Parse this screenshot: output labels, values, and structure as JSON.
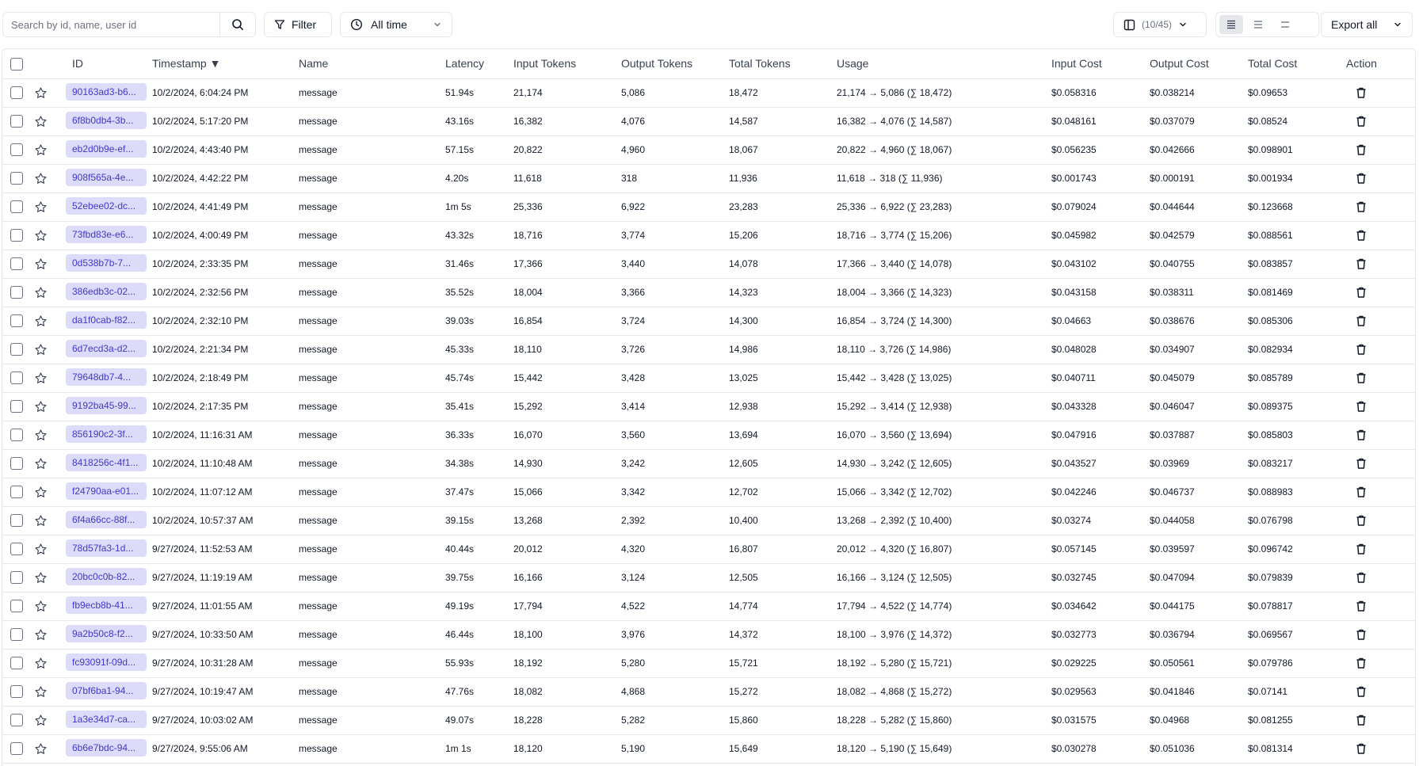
{
  "toolbar": {
    "search_placeholder": "Search by id, name, user id",
    "filter_label": "Filter",
    "time_label": "All time",
    "columns_count": "(10/45)",
    "export_label": "Export all"
  },
  "table": {
    "headers": {
      "id": "ID",
      "timestamp": "Timestamp ▼",
      "name": "Name",
      "latency": "Latency",
      "input_tokens": "Input Tokens",
      "output_tokens": "Output Tokens",
      "total_tokens": "Total Tokens",
      "usage": "Usage",
      "input_cost": "Input Cost",
      "output_cost": "Output Cost",
      "total_cost": "Total Cost",
      "action": "Action"
    },
    "rows": [
      {
        "id": "90163ad3-b6...",
        "timestamp": "10/2/2024, 6:04:24 PM",
        "name": "message",
        "latency": "51.94s",
        "input_tokens": "21,174",
        "output_tokens": "5,086",
        "total_tokens": "18,472",
        "usage": "21,174 → 5,086 (∑ 18,472)",
        "input_cost": "$0.058316",
        "output_cost": "$0.038214",
        "total_cost": "$0.09653"
      },
      {
        "id": "6f8b0db4-3b...",
        "timestamp": "10/2/2024, 5:17:20 PM",
        "name": "message",
        "latency": "43.16s",
        "input_tokens": "16,382",
        "output_tokens": "4,076",
        "total_tokens": "14,587",
        "usage": "16,382 → 4,076 (∑ 14,587)",
        "input_cost": "$0.048161",
        "output_cost": "$0.037079",
        "total_cost": "$0.08524"
      },
      {
        "id": "eb2d0b9e-ef...",
        "timestamp": "10/2/2024, 4:43:40 PM",
        "name": "message",
        "latency": "57.15s",
        "input_tokens": "20,822",
        "output_tokens": "4,960",
        "total_tokens": "18,067",
        "usage": "20,822 → 4,960 (∑ 18,067)",
        "input_cost": "$0.056235",
        "output_cost": "$0.042666",
        "total_cost": "$0.098901"
      },
      {
        "id": "908f565a-4e...",
        "timestamp": "10/2/2024, 4:42:22 PM",
        "name": "message",
        "latency": "4.20s",
        "input_tokens": "11,618",
        "output_tokens": "318",
        "total_tokens": "11,936",
        "usage": "11,618 → 318 (∑ 11,936)",
        "input_cost": "$0.001743",
        "output_cost": "$0.000191",
        "total_cost": "$0.001934"
      },
      {
        "id": "52ebee02-dc...",
        "timestamp": "10/2/2024, 4:41:49 PM",
        "name": "message",
        "latency": "1m 5s",
        "input_tokens": "25,336",
        "output_tokens": "6,922",
        "total_tokens": "23,283",
        "usage": "25,336 → 6,922 (∑ 23,283)",
        "input_cost": "$0.079024",
        "output_cost": "$0.044644",
        "total_cost": "$0.123668"
      },
      {
        "id": "73fbd83e-e6...",
        "timestamp": "10/2/2024, 4:00:49 PM",
        "name": "message",
        "latency": "43.32s",
        "input_tokens": "18,716",
        "output_tokens": "3,774",
        "total_tokens": "15,206",
        "usage": "18,716 → 3,774 (∑ 15,206)",
        "input_cost": "$0.045982",
        "output_cost": "$0.042579",
        "total_cost": "$0.088561"
      },
      {
        "id": "0d538b7b-7...",
        "timestamp": "10/2/2024, 2:33:35 PM",
        "name": "message",
        "latency": "31.46s",
        "input_tokens": "17,366",
        "output_tokens": "3,440",
        "total_tokens": "14,078",
        "usage": "17,366 → 3,440 (∑ 14,078)",
        "input_cost": "$0.043102",
        "output_cost": "$0.040755",
        "total_cost": "$0.083857"
      },
      {
        "id": "386edb3c-02...",
        "timestamp": "10/2/2024, 2:32:56 PM",
        "name": "message",
        "latency": "35.52s",
        "input_tokens": "18,004",
        "output_tokens": "3,366",
        "total_tokens": "14,323",
        "usage": "18,004 → 3,366 (∑ 14,323)",
        "input_cost": "$0.043158",
        "output_cost": "$0.038311",
        "total_cost": "$0.081469"
      },
      {
        "id": "da1f0cab-f82...",
        "timestamp": "10/2/2024, 2:32:10 PM",
        "name": "message",
        "latency": "39.03s",
        "input_tokens": "16,854",
        "output_tokens": "3,724",
        "total_tokens": "14,300",
        "usage": "16,854 → 3,724 (∑ 14,300)",
        "input_cost": "$0.04663",
        "output_cost": "$0.038676",
        "total_cost": "$0.085306"
      },
      {
        "id": "6d7ecd3a-d2...",
        "timestamp": "10/2/2024, 2:21:34 PM",
        "name": "message",
        "latency": "45.33s",
        "input_tokens": "18,110",
        "output_tokens": "3,726",
        "total_tokens": "14,986",
        "usage": "18,110 → 3,726 (∑ 14,986)",
        "input_cost": "$0.048028",
        "output_cost": "$0.034907",
        "total_cost": "$0.082934"
      },
      {
        "id": "79648db7-4...",
        "timestamp": "10/2/2024, 2:18:49 PM",
        "name": "message",
        "latency": "45.74s",
        "input_tokens": "15,442",
        "output_tokens": "3,428",
        "total_tokens": "13,025",
        "usage": "15,442 → 3,428 (∑ 13,025)",
        "input_cost": "$0.040711",
        "output_cost": "$0.045079",
        "total_cost": "$0.085789"
      },
      {
        "id": "9192ba45-99...",
        "timestamp": "10/2/2024, 2:17:35 PM",
        "name": "message",
        "latency": "35.41s",
        "input_tokens": "15,292",
        "output_tokens": "3,414",
        "total_tokens": "12,938",
        "usage": "15,292 → 3,414 (∑ 12,938)",
        "input_cost": "$0.043328",
        "output_cost": "$0.046047",
        "total_cost": "$0.089375"
      },
      {
        "id": "856190c2-3f...",
        "timestamp": "10/2/2024, 11:16:31 AM",
        "name": "message",
        "latency": "36.33s",
        "input_tokens": "16,070",
        "output_tokens": "3,560",
        "total_tokens": "13,694",
        "usage": "16,070 → 3,560 (∑ 13,694)",
        "input_cost": "$0.047916",
        "output_cost": "$0.037887",
        "total_cost": "$0.085803"
      },
      {
        "id": "8418256c-4f1...",
        "timestamp": "10/2/2024, 11:10:48 AM",
        "name": "message",
        "latency": "34.38s",
        "input_tokens": "14,930",
        "output_tokens": "3,242",
        "total_tokens": "12,605",
        "usage": "14,930 → 3,242 (∑ 12,605)",
        "input_cost": "$0.043527",
        "output_cost": "$0.03969",
        "total_cost": "$0.083217"
      },
      {
        "id": "f24790aa-e01...",
        "timestamp": "10/2/2024, 11:07:12 AM",
        "name": "message",
        "latency": "37.47s",
        "input_tokens": "15,066",
        "output_tokens": "3,342",
        "total_tokens": "12,702",
        "usage": "15,066 → 3,342 (∑ 12,702)",
        "input_cost": "$0.042246",
        "output_cost": "$0.046737",
        "total_cost": "$0.088983"
      },
      {
        "id": "6f4a66cc-88f...",
        "timestamp": "10/2/2024, 10:57:37 AM",
        "name": "message",
        "latency": "39.15s",
        "input_tokens": "13,268",
        "output_tokens": "2,392",
        "total_tokens": "10,400",
        "usage": "13,268 → 2,392 (∑ 10,400)",
        "input_cost": "$0.03274",
        "output_cost": "$0.044058",
        "total_cost": "$0.076798"
      },
      {
        "id": "78d57fa3-1d...",
        "timestamp": "9/27/2024, 11:52:53 AM",
        "name": "message",
        "latency": "40.44s",
        "input_tokens": "20,012",
        "output_tokens": "4,320",
        "total_tokens": "16,807",
        "usage": "20,012 → 4,320 (∑ 16,807)",
        "input_cost": "$0.057145",
        "output_cost": "$0.039597",
        "total_cost": "$0.096742"
      },
      {
        "id": "20bc0c0b-82...",
        "timestamp": "9/27/2024, 11:19:19 AM",
        "name": "message",
        "latency": "39.75s",
        "input_tokens": "16,166",
        "output_tokens": "3,124",
        "total_tokens": "12,505",
        "usage": "16,166 → 3,124 (∑ 12,505)",
        "input_cost": "$0.032745",
        "output_cost": "$0.047094",
        "total_cost": "$0.079839"
      },
      {
        "id": "fb9ecb8b-41...",
        "timestamp": "9/27/2024, 11:01:55 AM",
        "name": "message",
        "latency": "49.19s",
        "input_tokens": "17,794",
        "output_tokens": "4,522",
        "total_tokens": "14,774",
        "usage": "17,794 → 4,522 (∑ 14,774)",
        "input_cost": "$0.034642",
        "output_cost": "$0.044175",
        "total_cost": "$0.078817"
      },
      {
        "id": "9a2b50c8-f2...",
        "timestamp": "9/27/2024, 10:33:50 AM",
        "name": "message",
        "latency": "46.44s",
        "input_tokens": "18,100",
        "output_tokens": "3,976",
        "total_tokens": "14,372",
        "usage": "18,100 → 3,976 (∑ 14,372)",
        "input_cost": "$0.032773",
        "output_cost": "$0.036794",
        "total_cost": "$0.069567"
      },
      {
        "id": "fc93091f-09d...",
        "timestamp": "9/27/2024, 10:31:28 AM",
        "name": "message",
        "latency": "55.93s",
        "input_tokens": "18,192",
        "output_tokens": "5,280",
        "total_tokens": "15,721",
        "usage": "18,192 → 5,280 (∑ 15,721)",
        "input_cost": "$0.029225",
        "output_cost": "$0.050561",
        "total_cost": "$0.079786"
      },
      {
        "id": "07bf6ba1-94...",
        "timestamp": "9/27/2024, 10:19:47 AM",
        "name": "message",
        "latency": "47.76s",
        "input_tokens": "18,082",
        "output_tokens": "4,868",
        "total_tokens": "15,272",
        "usage": "18,082 → 4,868 (∑ 15,272)",
        "input_cost": "$0.029563",
        "output_cost": "$0.041846",
        "total_cost": "$0.07141"
      },
      {
        "id": "1a3e34d7-ca...",
        "timestamp": "9/27/2024, 10:03:02 AM",
        "name": "message",
        "latency": "49.07s",
        "input_tokens": "18,228",
        "output_tokens": "5,282",
        "total_tokens": "15,860",
        "usage": "18,228 → 5,282 (∑ 15,860)",
        "input_cost": "$0.031575",
        "output_cost": "$0.04968",
        "total_cost": "$0.081255"
      },
      {
        "id": "6b6e7bdc-94...",
        "timestamp": "9/27/2024, 9:55:06 AM",
        "name": "message",
        "latency": "1m 1s",
        "input_tokens": "18,120",
        "output_tokens": "5,190",
        "total_tokens": "15,649",
        "usage": "18,120 → 5,190 (∑ 15,649)",
        "input_cost": "$0.030278",
        "output_cost": "$0.051036",
        "total_cost": "$0.081314"
      }
    ]
  }
}
